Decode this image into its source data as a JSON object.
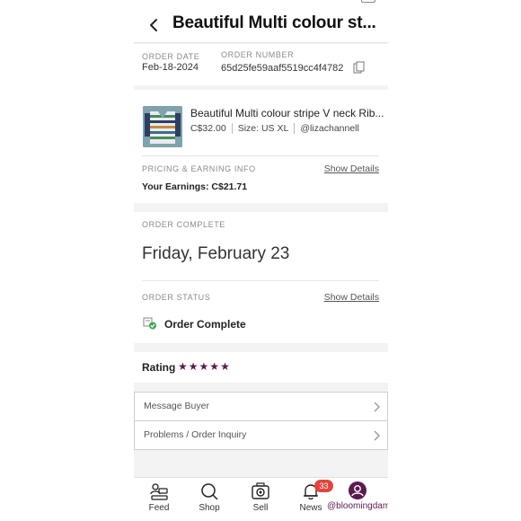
{
  "header": {
    "title": "Beautiful Multi colour st..."
  },
  "order_meta": {
    "date_label": "ORDER DATE",
    "date_value": "Feb-18-2024",
    "number_label": "ORDER NUMBER",
    "number_value": "65d25fe59aaf5519cc4f4782"
  },
  "product": {
    "title": "Beautiful Multi colour stripe V neck Rib...",
    "price": "C$32.00",
    "size": "Size: US XL",
    "seller": "@lizachannell",
    "pricing_label": "PRICING & EARNING INFO",
    "show_details": "Show Details",
    "earnings": "Your Earnings: C$21.71"
  },
  "status": {
    "complete_label": "ORDER COMPLETE",
    "complete_date": "Friday, February 23",
    "status_label": "ORDER STATUS",
    "show_details": "Show Details",
    "status_text": "Order Complete",
    "status_color": "#3aa856"
  },
  "rating": {
    "label": "Rating",
    "stars": 5,
    "star_color": "#5b1b4e"
  },
  "actions": {
    "message_buyer": "Message Buyer",
    "problems": "Problems / Order Inquiry"
  },
  "tabbar": {
    "feed": "Feed",
    "shop": "Shop",
    "sell": "Sell",
    "news": "News",
    "news_badge": "33",
    "me": "@bloomingdam"
  },
  "colors": {
    "brand": "#5b1b4e",
    "badge": "#e2453c"
  }
}
